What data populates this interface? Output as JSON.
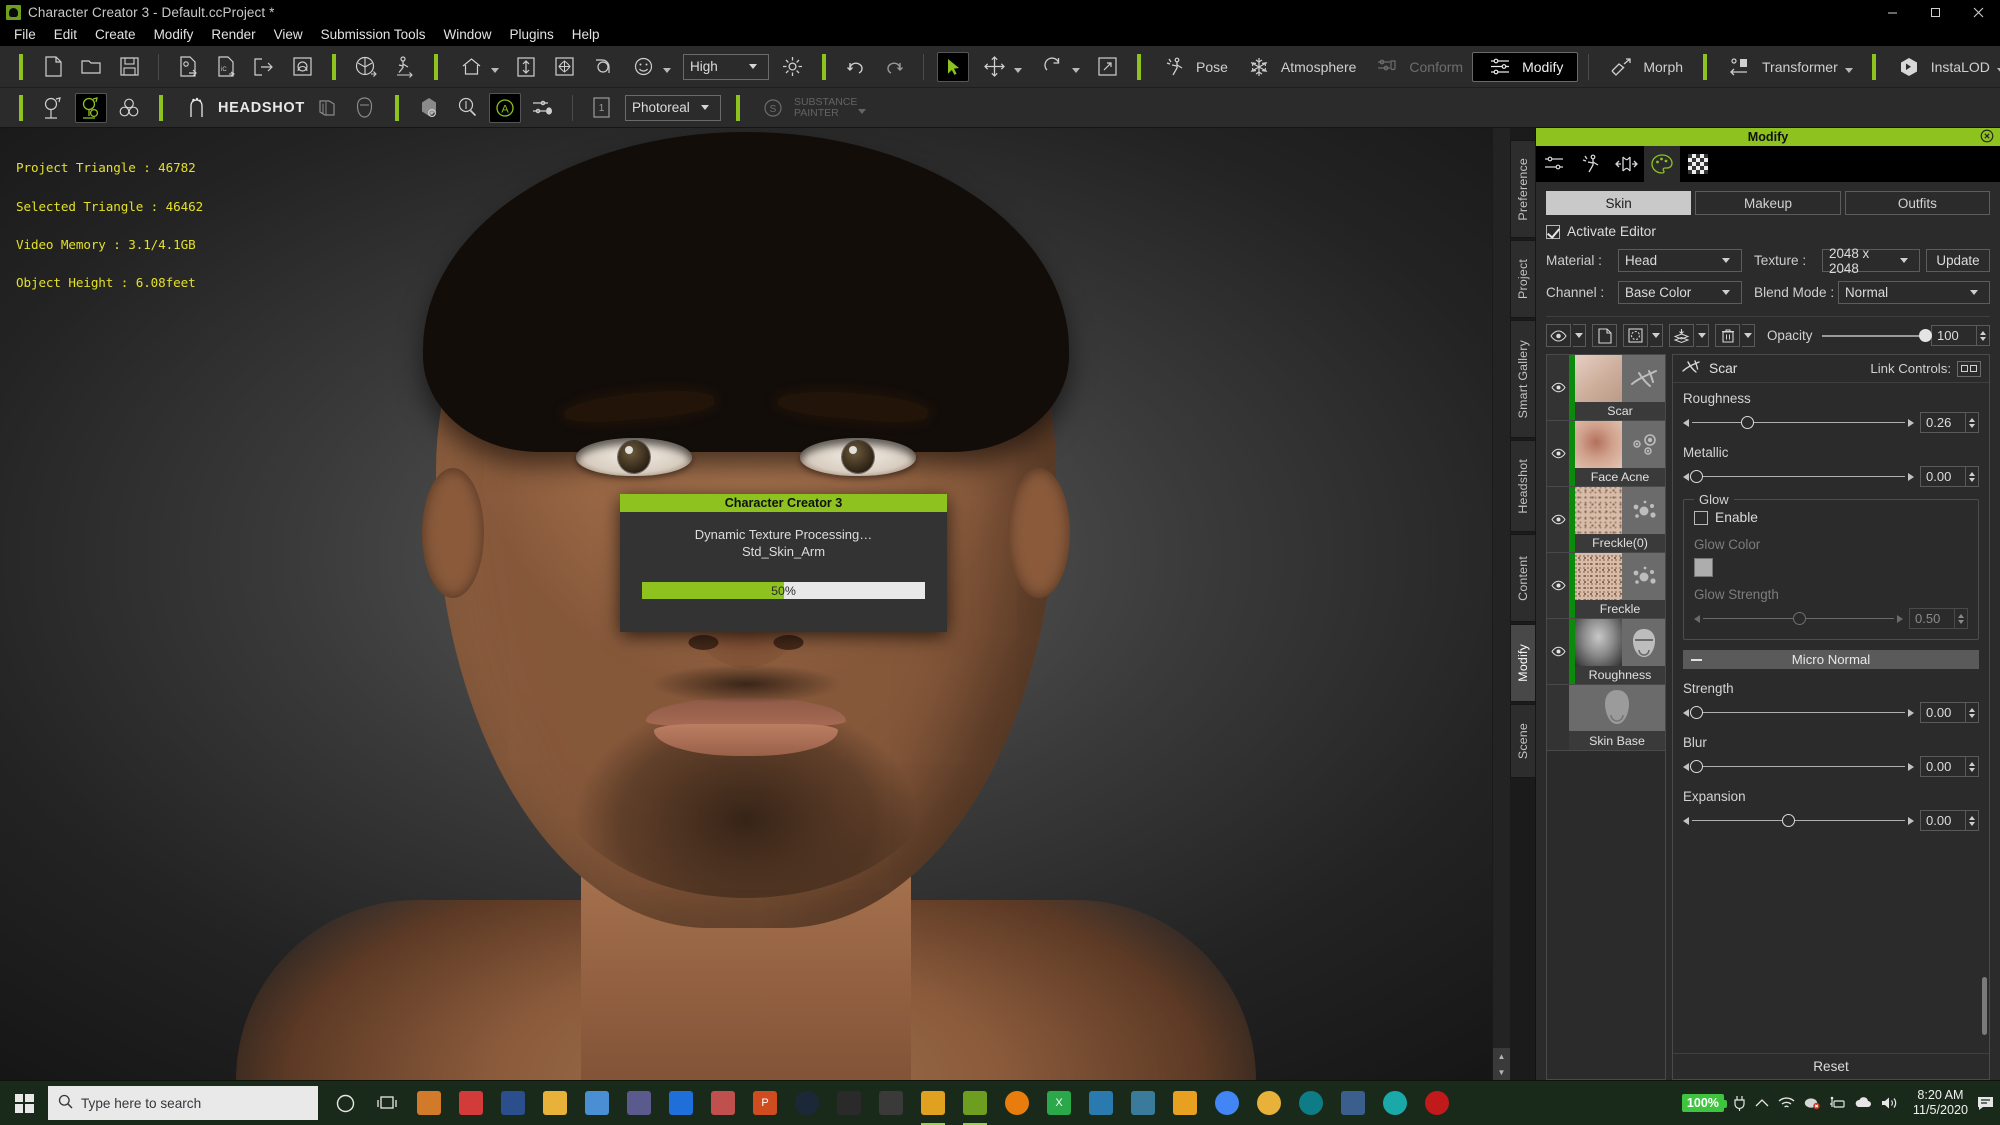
{
  "window": {
    "title": "Character Creator 3 - Default.ccProject *",
    "app_icon": "character-creator-icon",
    "minimize": "–",
    "maximize": "❑",
    "close": "✕"
  },
  "menubar": {
    "items": [
      "File",
      "Edit",
      "Create",
      "Modify",
      "Render",
      "View",
      "Submission Tools",
      "Window",
      "Plugins",
      "Help"
    ]
  },
  "toolbar_main": {
    "quality_select": "High",
    "pose_label": "Pose",
    "atmosphere_label": "Atmosphere",
    "conform_label": "Conform",
    "modify_label": "Modify",
    "morph_label": "Morph",
    "transformer_label": "Transformer",
    "instalod_label": "InstaLOD"
  },
  "toolbar_second": {
    "headshot_label": "HEADSHOT",
    "render_select": "Photoreal",
    "substance_label_1": "SUBSTANCE",
    "substance_label_2": "PAINTER"
  },
  "viewport": {
    "stats": [
      "Project Triangle : 46782",
      "Selected Triangle : 46462",
      "Video Memory : 3.1/4.1GB",
      "Object Height : 6.08feet"
    ],
    "stats_color": "#e3e02a"
  },
  "dialog": {
    "title": "Character Creator 3",
    "line1": "Dynamic Texture Processing…",
    "line2": "Std_Skin_Arm",
    "progress_text": "50%",
    "progress_percent": 50,
    "accent_color": "#8dc21f"
  },
  "side_tabs": [
    {
      "label": "Preference",
      "active": false
    },
    {
      "label": "Project",
      "active": false
    },
    {
      "label": "Smart Gallery",
      "active": false
    },
    {
      "label": "Headshot",
      "active": false
    },
    {
      "label": "Content",
      "active": false
    },
    {
      "label": "Modify",
      "active": true
    },
    {
      "label": "Scene",
      "active": false
    }
  ],
  "panel": {
    "title": "Modify",
    "accent_color": "#8dc21f",
    "icon_tabs": [
      {
        "name": "sliders-icon",
        "active": false
      },
      {
        "name": "pose-icon",
        "active": false
      },
      {
        "name": "scale-icon",
        "active": false
      },
      {
        "name": "palette-icon",
        "active": true
      },
      {
        "name": "checker-icon",
        "active": false
      }
    ],
    "mode_tabs": [
      {
        "label": "Skin",
        "active": true
      },
      {
        "label": "Makeup",
        "active": false
      },
      {
        "label": "Outfits",
        "active": false
      }
    ],
    "activate_editor": {
      "label": "Activate Editor",
      "checked": true
    },
    "material": {
      "label": "Material :",
      "value": "Head"
    },
    "texture": {
      "label": "Texture :",
      "value": "2048 x 2048"
    },
    "update_button": "Update",
    "channel": {
      "label": "Channel :",
      "value": "Base Color"
    },
    "blend_mode": {
      "label": "Blend Mode :",
      "value": "Normal"
    },
    "layer_tools": [
      {
        "name": "eye-visibility-icon",
        "has_caret": true
      },
      {
        "name": "duplicate-layer-icon",
        "has_caret": false
      },
      {
        "name": "select-region-icon",
        "has_caret": true
      },
      {
        "name": "merge-layers-icon",
        "has_caret": true
      },
      {
        "name": "delete-layer-icon",
        "has_caret": true
      }
    ],
    "opacity": {
      "label": "Opacity",
      "value": "100",
      "percent": 100
    }
  },
  "layers": [
    {
      "name": "Scar",
      "visible": true,
      "icon": "scar-icon",
      "thumb_from": "#e6cfc2",
      "thumb_to": "#c9a894"
    },
    {
      "name": "Face Acne",
      "visible": true,
      "icon": "acne-icon",
      "thumb_from": "#e0c0b0",
      "thumb_to": "#b07a68"
    },
    {
      "name": "Freckle(0)",
      "visible": true,
      "icon": "freckle-icon",
      "thumb_from": "#ddc4b4",
      "thumb_to": "#bf9d8a"
    },
    {
      "name": "Freckle",
      "visible": true,
      "icon": "freckle-icon",
      "thumb_from": "#ddc4b4",
      "thumb_to": "#bf9d8a"
    },
    {
      "name": "Roughness",
      "visible": true,
      "icon": "head-mask-icon",
      "thumb_from": "#9a9a9a",
      "thumb_to": "#4a4a4a"
    },
    {
      "name": "Skin Base",
      "visible": false,
      "icon": "skin-base-icon",
      "thumb_from": "#6b6b6b",
      "thumb_to": "#6b6b6b"
    }
  ],
  "properties": {
    "layer_icon": "scar-icon",
    "layer_title": "Scar",
    "link_controls_label": "Link Controls:",
    "roughness": {
      "label": "Roughness",
      "value": "0.26",
      "percent": 26
    },
    "metallic": {
      "label": "Metallic",
      "value": "0.00",
      "percent": 2
    },
    "glow": {
      "title": "Glow",
      "enable_label": "Enable",
      "enabled": false,
      "color_label": "Glow Color",
      "color_value": "#adadad",
      "strength_label": "Glow Strength",
      "strength_value": "0.50",
      "strength_percent": 50
    },
    "micro_normal": {
      "label": "Micro Normal",
      "collapsed": false
    },
    "strength": {
      "label": "Strength",
      "value": "0.00",
      "percent": 2
    },
    "blur": {
      "label": "Blur",
      "value": "0.00",
      "percent": 2
    },
    "expansion": {
      "label": "Expansion",
      "value": "0.00",
      "percent": 45
    },
    "reset_button": "Reset"
  },
  "taskbar": {
    "search_placeholder": "Type here to search",
    "tasks": [
      {
        "name": "cortana-circle-icon",
        "color": "#1a2a1a",
        "glyph": "○",
        "active": false
      },
      {
        "name": "task-view-icon",
        "color": "#1a2a1a",
        "glyph": "❐",
        "active": false
      },
      {
        "name": "store-icon",
        "color": "#d07a2a",
        "glyph": "",
        "active": false
      },
      {
        "name": "reader-icon",
        "color": "#d33b3b",
        "glyph": "",
        "active": false
      },
      {
        "name": "office-icon",
        "color": "#2b4e8c",
        "glyph": "",
        "active": false
      },
      {
        "name": "file-explorer-icon",
        "color": "#e8b23a",
        "glyph": "",
        "active": false
      },
      {
        "name": "calculator-icon",
        "color": "#4a8fd4",
        "glyph": "",
        "active": false
      },
      {
        "name": "video-icon",
        "color": "#5a5a8c",
        "glyph": "",
        "active": false
      },
      {
        "name": "mail-icon",
        "color": "#1e6fd9",
        "glyph": "",
        "active": false
      },
      {
        "name": "photos-icon",
        "color": "#c0504d",
        "glyph": "",
        "active": false
      },
      {
        "name": "powerpoint-icon",
        "color": "#cf4b20",
        "glyph": "P",
        "active": false
      },
      {
        "name": "steam-icon",
        "color": "#1b2838",
        "glyph": "",
        "active": false
      },
      {
        "name": "epic-games-icon",
        "color": "#2a2a2a",
        "glyph": "",
        "active": false
      },
      {
        "name": "media-player-icon",
        "color": "#3a3a3a",
        "glyph": "",
        "active": false
      },
      {
        "name": "iclone-icon",
        "color": "#e0a020",
        "glyph": "",
        "active": true
      },
      {
        "name": "character-creator-icon",
        "color": "#6d9e1f",
        "glyph": "",
        "active": true
      },
      {
        "name": "blender-icon",
        "color": "#e87d0d",
        "glyph": "",
        "active": false
      },
      {
        "name": "xmind-icon",
        "color": "#2aa84a",
        "glyph": "X",
        "active": false
      },
      {
        "name": "3ds-max-icon",
        "color": "#2a7ab0",
        "glyph": "",
        "active": false
      },
      {
        "name": "substance-icon",
        "color": "#3a7a9a",
        "glyph": "",
        "active": false
      },
      {
        "name": "vegas-icon",
        "color": "#e8a020",
        "glyph": "",
        "active": false
      },
      {
        "name": "chrome-icon",
        "color": "#4285f4",
        "glyph": "",
        "active": false
      },
      {
        "name": "audacity-icon",
        "color": "#e8b23a",
        "glyph": "",
        "active": false
      },
      {
        "name": "edge-icon",
        "color": "#0e7c86",
        "glyph": "",
        "active": false
      },
      {
        "name": "obs-icon",
        "color": "#3a5f8c",
        "glyph": "",
        "active": false
      },
      {
        "name": "wacom-icon",
        "color": "#1aa8a8",
        "glyph": "",
        "active": false
      }
    ],
    "tray": {
      "battery_text": "100%",
      "time": "8:20 AM",
      "date": "11/5/2020",
      "icons": [
        "power-plug-icon",
        "chevron-up-icon",
        "wifi-icon",
        "bluetooth-off-icon",
        "network-icon",
        "onedrive-icon",
        "volume-icon"
      ],
      "action_center": "notification-icon"
    }
  }
}
